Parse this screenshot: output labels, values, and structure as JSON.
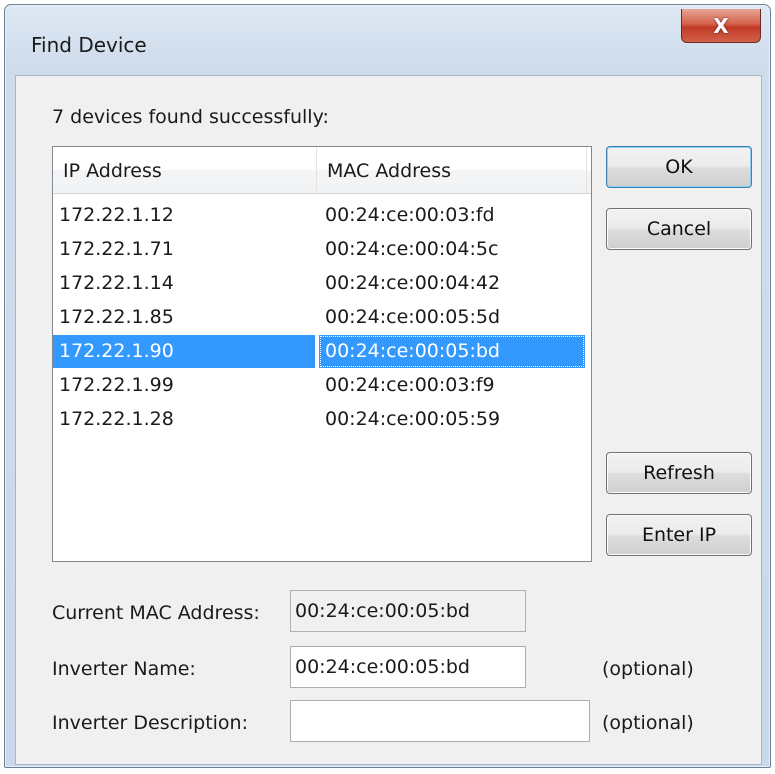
{
  "window": {
    "title": "Find Device",
    "close_label": "X"
  },
  "status_text": "7 devices found successfully:",
  "table": {
    "columns": [
      "IP Address",
      "MAC Address"
    ],
    "rows": [
      {
        "ip": "172.22.1.12",
        "mac": "00:24:ce:00:03:fd"
      },
      {
        "ip": "172.22.1.71",
        "mac": "00:24:ce:00:04:5c"
      },
      {
        "ip": "172.22.1.14",
        "mac": "00:24:ce:00:04:42"
      },
      {
        "ip": "172.22.1.85",
        "mac": "00:24:ce:00:05:5d"
      },
      {
        "ip": "172.22.1.90",
        "mac": "00:24:ce:00:05:bd"
      },
      {
        "ip": "172.22.1.99",
        "mac": "00:24:ce:00:03:f9"
      },
      {
        "ip": "172.22.1.28",
        "mac": "00:24:ce:00:05:59"
      }
    ],
    "selected_ip": "172.22.1.90"
  },
  "buttons": {
    "ok": "OK",
    "cancel": "Cancel",
    "refresh": "Refresh",
    "enter_ip": "Enter IP"
  },
  "form": {
    "current_mac_label": "Current MAC Address:",
    "current_mac_value": "00:24:ce:00:05:bd",
    "name_label": "Inverter Name:",
    "name_value": "00:24:ce:00:05:bd",
    "name_hint": "(optional)",
    "desc_label": "Inverter Description:",
    "desc_value": "",
    "desc_hint": "(optional)"
  },
  "colors": {
    "selection": "#3399ff",
    "close_button": "#c23a24"
  },
  "icons": {
    "close": "close-icon"
  }
}
